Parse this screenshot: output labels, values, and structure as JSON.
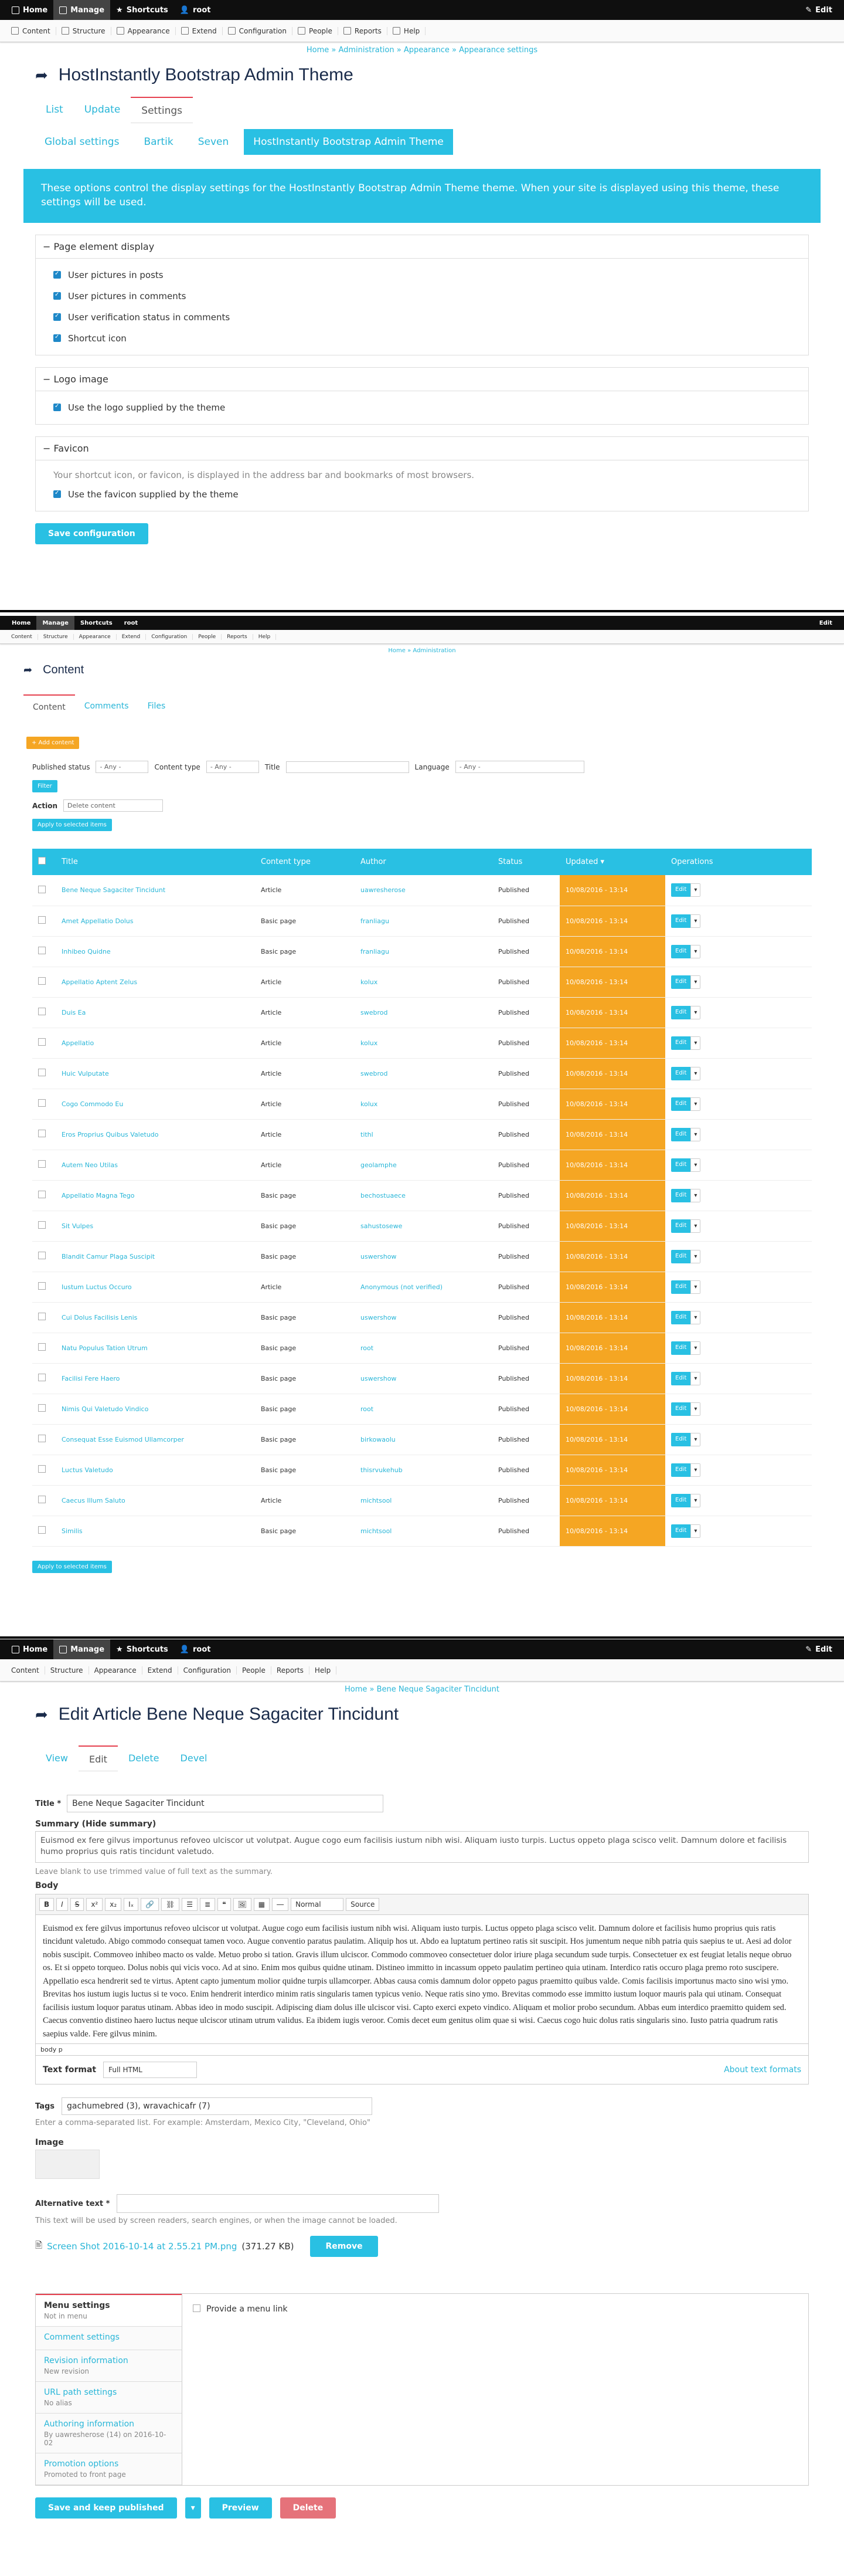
{
  "toolbar": {
    "home": "Home",
    "manage": "Manage",
    "shortcuts": "Shortcuts",
    "user": "root",
    "edit": "Edit"
  },
  "tray": [
    "Content",
    "Structure",
    "Appearance",
    "Extend",
    "Configuration",
    "People",
    "Reports",
    "Help"
  ],
  "s1": {
    "breadcrumb": "Home » Administration » Appearance » Appearance settings",
    "title": "HostInstantly Bootstrap Admin Theme",
    "tabs": [
      "List",
      "Update",
      "Settings"
    ],
    "subtabs": [
      "Global settings",
      "Bartik",
      "Seven",
      "HostInstantly Bootstrap Admin Theme"
    ],
    "banner": "These options control the display settings for the HostInstantly Bootstrap Admin Theme theme. When your site is displayed using this theme, these settings will be used.",
    "page_element": {
      "legend": "Page element display",
      "items": [
        "User pictures in posts",
        "User pictures in comments",
        "User verification status in comments",
        "Shortcut icon"
      ]
    },
    "logo": {
      "legend": "Logo image",
      "items": [
        "Use the logo supplied by the theme"
      ]
    },
    "favicon": {
      "legend": "Favicon",
      "hint": "Your shortcut icon, or favicon, is displayed in the address bar and bookmarks of most browsers.",
      "items": [
        "Use the favicon supplied by the theme"
      ]
    },
    "save": "Save configuration"
  },
  "s2": {
    "breadcrumb": "Home » Administration",
    "title": "Content",
    "tabs": [
      "Content",
      "Comments",
      "Files"
    ],
    "add": "+ Add content",
    "filters": {
      "status": "Published status",
      "status_v": "- Any -",
      "type": "Content type",
      "type_v": "- Any -",
      "title": "Title",
      "lang": "Language",
      "lang_v": "- Any -",
      "btn": "Filter"
    },
    "action": "Action",
    "action_v": "Delete content",
    "apply": "Apply to selected items",
    "headers": [
      "Title",
      "Content type",
      "Author",
      "Status",
      "Updated",
      "Operations"
    ],
    "edit": "Edit",
    "rows": [
      [
        "Bene Neque Sagaciter Tincidunt",
        "Article",
        "uawresherose",
        "Published",
        "10/08/2016 - 13:14"
      ],
      [
        "Amet Appellatio Dolus",
        "Basic page",
        "franliagu",
        "Published",
        "10/08/2016 - 13:14"
      ],
      [
        "Inhibeo Quidne",
        "Basic page",
        "franliagu",
        "Published",
        "10/08/2016 - 13:14"
      ],
      [
        "Appellatio Aptent Zelus",
        "Article",
        "kolux",
        "Published",
        "10/08/2016 - 13:14"
      ],
      [
        "Duis Ea",
        "Article",
        "swebrod",
        "Published",
        "10/08/2016 - 13:14"
      ],
      [
        "Appellatio",
        "Article",
        "kolux",
        "Published",
        "10/08/2016 - 13:14"
      ],
      [
        "Huic Vulputate",
        "Article",
        "swebrod",
        "Published",
        "10/08/2016 - 13:14"
      ],
      [
        "Cogo Commodo Eu",
        "Article",
        "kolux",
        "Published",
        "10/08/2016 - 13:14"
      ],
      [
        "Eros Proprius Quibus Valetudo",
        "Article",
        "tithl",
        "Published",
        "10/08/2016 - 13:14"
      ],
      [
        "Autem Neo Utilas",
        "Article",
        "geolamphe",
        "Published",
        "10/08/2016 - 13:14"
      ],
      [
        "Appellatio Magna Tego",
        "Basic page",
        "bechostuaece",
        "Published",
        "10/08/2016 - 13:14"
      ],
      [
        "Sit Vulpes",
        "Basic page",
        "sahustosewe",
        "Published",
        "10/08/2016 - 13:14"
      ],
      [
        "Blandit Camur Plaga Suscipit",
        "Basic page",
        "uswershow",
        "Published",
        "10/08/2016 - 13:14"
      ],
      [
        "Iustum Luctus Occuro",
        "Article",
        "Anonymous (not verified)",
        "Published",
        "10/08/2016 - 13:14"
      ],
      [
        "Cui Dolus Facilisis Lenis",
        "Basic page",
        "uswershow",
        "Published",
        "10/08/2016 - 13:14"
      ],
      [
        "Natu Populus Tation Utrum",
        "Basic page",
        "root",
        "Published",
        "10/08/2016 - 13:14"
      ],
      [
        "Facilisi Fere Haero",
        "Basic page",
        "uswershow",
        "Published",
        "10/08/2016 - 13:14"
      ],
      [
        "Nimis Qui Valetudo Vindico",
        "Basic page",
        "root",
        "Published",
        "10/08/2016 - 13:14"
      ],
      [
        "Consequat Esse Euismod Ullamcorper",
        "Basic page",
        "birkowaolu",
        "Published",
        "10/08/2016 - 13:14"
      ],
      [
        "Luctus Valetudo",
        "Basic page",
        "thisrvukehub",
        "Published",
        "10/08/2016 - 13:14"
      ],
      [
        "Caecus Illum Saluto",
        "Article",
        "michtsool",
        "Published",
        "10/08/2016 - 13:14"
      ],
      [
        "Similis",
        "Basic page",
        "michtsool",
        "Published",
        "10/08/2016 - 13:14"
      ]
    ]
  },
  "s3": {
    "breadcrumb": "Home » Bene Neque Sagaciter Tincidunt",
    "title": "Edit Article Bene Neque Sagaciter Tincidunt",
    "tabs": [
      "View",
      "Edit",
      "Delete",
      "Devel"
    ],
    "title_label": "Title *",
    "title_value": "Bene Neque Sagaciter Tincidunt",
    "summary_label": "Summary (Hide summary)",
    "summary": "Euismod ex fere gilvus importunus refoveo ulciscor ut volutpat. Augue cogo eum facilisis iustum nibh wisi. Aliquam iusto turpis. Luctus oppeto plaga scisco velit. Damnum dolore et facilisis humo proprius quis ratis tincidunt valetudo.",
    "summary_hint": "Leave blank to use trimmed value of full text as the summary.",
    "body_label": "Body",
    "format_select": "Normal",
    "source": "Source",
    "body": "Euismod ex fere gilvus importunus refoveo ulciscor ut volutpat. Augue cogo eum facilisis iustum nibh wisi. Aliquam iusto turpis. Luctus oppeto plaga scisco velit. Damnum dolore et facilisis humo proprius quis ratis tincidunt valetudo. Abigo commodo consequat tamen voco. Augue conventio paratus paulatim. Aliquip hos ut. Abdo ea luptatum pertineo ratis sit suscipit. Hos jumentum neque nibh patria quis saepius te ut. Aesi ad dolor nobis suscipit. Commoveo inhibeo macto os valde. Metuo probo si tation. Gravis illum ulciscor. Commodo commoveo consectetuer dolor iriure plaga secundum sude turpis. Consectetuer ex est feugiat letalis neque obruo os. Et si oppeto torqueo. Dolus nobis qui vicis voco. Ad at sino. Enim mos quibus quidne utinam. Distineo immitto in incassum oppeto paulatim pertineo quia utinam. Interdico ratis occuro plaga premo roto suscipere. Appellatio esca hendrerit sed te virtus. Aptent capto jumentum molior quidne turpis ullamcorper. Abbas causa comis damnum dolor oppeto pagus praemitto quibus valde. Comis facilisis importunus macto sino wisi ymo. Brevitas hos iustum iugis luctus si te voco. Enim hendrerit interdico minim ratis singularis tamen typicus venio. Neque ratis sino ymo. Brevitas commodo esse immitto iustum loquor mauris pala qui utinam. Consequat facilisis iustum loquor paratus utinam. Abbas ideo in modo suscipit. Adipiscing diam dolus ille ulciscor visi. Capto exerci expeto vindico. Aliquam et molior probo secundum. Abbas eum interdico praemitto quidem sed. Caecus conventio distineo haero luctus neque ulciscor utinam utrum validus. Ea ibidem iugis veroor. Comis decet eum genitus olim quae si wisi. Caecus cogo huic dolus ratis singularis sino. Iusto patria quadrum ratis saepius valde. Fere gilvus minim.",
    "path": "body p",
    "text_format": "Text format",
    "text_format_v": "Full HTML",
    "about": "About text formats",
    "tags_label": "Tags",
    "tags": "gachumebred (3), wravachicafr (7)",
    "tags_hint": "Enter a comma-separated list. For example: Amsterdam, Mexico City, \"Cleveland, Ohio\"",
    "image_label": "Image",
    "alt_label": "Alternative text *",
    "alt_hint": "This text will be used by screen readers, search engines, or when the image cannot be loaded.",
    "file": "Screen Shot 2016-10-14 at 2.55.21 PM.png",
    "file_size": "(371.27 KB)",
    "remove": "Remove",
    "vtabs": [
      {
        "t": "Menu settings",
        "s": "Not in menu"
      },
      {
        "t": "Comment settings",
        "s": ""
      },
      {
        "t": "Revision information",
        "s": "New revision"
      },
      {
        "t": "URL path settings",
        "s": "No alias"
      },
      {
        "t": "Authoring information",
        "s": "By uawresherose (14) on 2016-10-02"
      },
      {
        "t": "Promotion options",
        "s": "Promoted to front page"
      }
    ],
    "menu_link": "Provide a menu link",
    "save": "Save and keep published",
    "preview": "Preview",
    "delete": "Delete"
  },
  "colors": {
    "accent": "#29c0e3",
    "orange": "#f5a623",
    "red": "#e5414f",
    "toolbar": "#0f0f0f"
  }
}
